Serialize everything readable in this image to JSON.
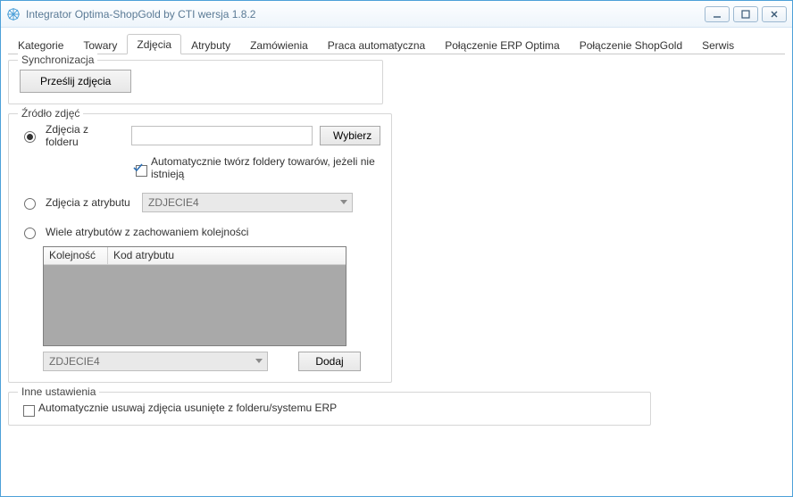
{
  "window": {
    "title": "Integrator Optima-ShopGold by CTI wersja 1.8.2"
  },
  "tabs": [
    {
      "label": "Kategorie"
    },
    {
      "label": "Towary"
    },
    {
      "label": "Zdjęcia"
    },
    {
      "label": "Atrybuty"
    },
    {
      "label": "Zamówienia"
    },
    {
      "label": "Praca automatyczna"
    },
    {
      "label": "Połączenie ERP Optima"
    },
    {
      "label": "Połączenie ShopGold"
    },
    {
      "label": "Serwis"
    }
  ],
  "active_tab_index": 2,
  "sync": {
    "legend": "Synchronizacja",
    "upload_btn": "Prześlij zdjęcia"
  },
  "source": {
    "legend": "Źródło zdjęć",
    "opt_folder": "Zdjęcia z folderu",
    "folder_path": "",
    "browse_btn": "Wybierz",
    "auto_create_folders": "Automatycznie twórz foldery towarów, jeżeli nie istnieją",
    "auto_create_folders_checked": true,
    "opt_attr": "Zdjęcia z atrybutu",
    "attr_select": "ZDJECIE4",
    "opt_multi": "Wiele atrybutów z zachowaniem kolejności",
    "grid_cols": {
      "order": "Kolejność",
      "code": "Kod atrybutu"
    },
    "multi_select": "ZDJECIE4",
    "add_btn": "Dodaj",
    "selected": "folder"
  },
  "other": {
    "legend": "Inne ustawienia",
    "auto_delete": "Automatycznie usuwaj zdjęcia usunięte z folderu/systemu ERP",
    "auto_delete_checked": false
  }
}
